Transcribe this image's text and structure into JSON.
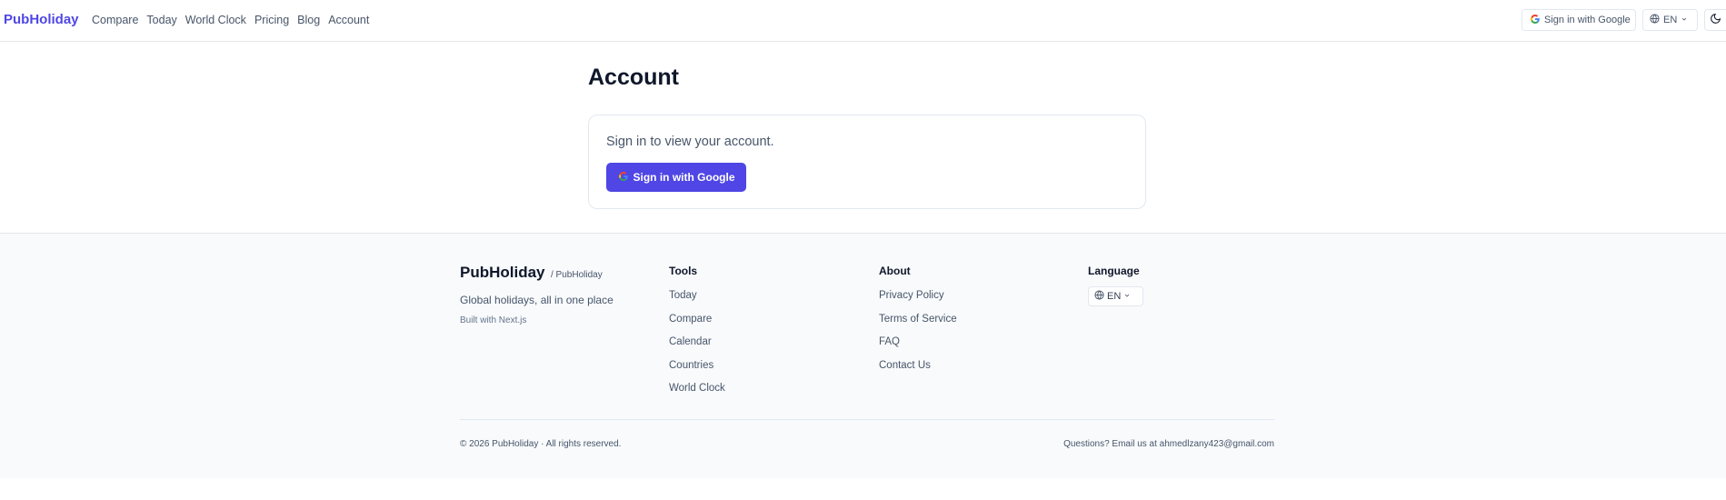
{
  "header": {
    "brand": "PubHoliday",
    "nav": [
      "Compare",
      "Today",
      "World Clock",
      "Pricing",
      "Blog",
      "Account"
    ],
    "sign_in_label": "Sign in with Google",
    "language": "EN"
  },
  "main": {
    "title": "Account",
    "card_text": "Sign in to view your account.",
    "sign_in_button": "Sign in with Google",
    "accent_color": "#4f46e5"
  },
  "footer": {
    "brand": "PubHoliday",
    "handle": "/ PubHoliday",
    "tagline": "Global holidays, all in one place",
    "built_with": "Built with Next.js",
    "tools": {
      "title": "Tools",
      "links": [
        "Today",
        "Compare",
        "Calendar",
        "Countries",
        "World Clock"
      ]
    },
    "about": {
      "title": "About",
      "links": [
        "Privacy Policy",
        "Terms of Service",
        "FAQ",
        "Contact Us"
      ]
    },
    "language": {
      "title": "Language",
      "value": "EN"
    },
    "copyright": "© 2026 PubHoliday · All rights reserved.",
    "contact": "Questions? Email us at ahmedlzany423@gmail.com"
  }
}
